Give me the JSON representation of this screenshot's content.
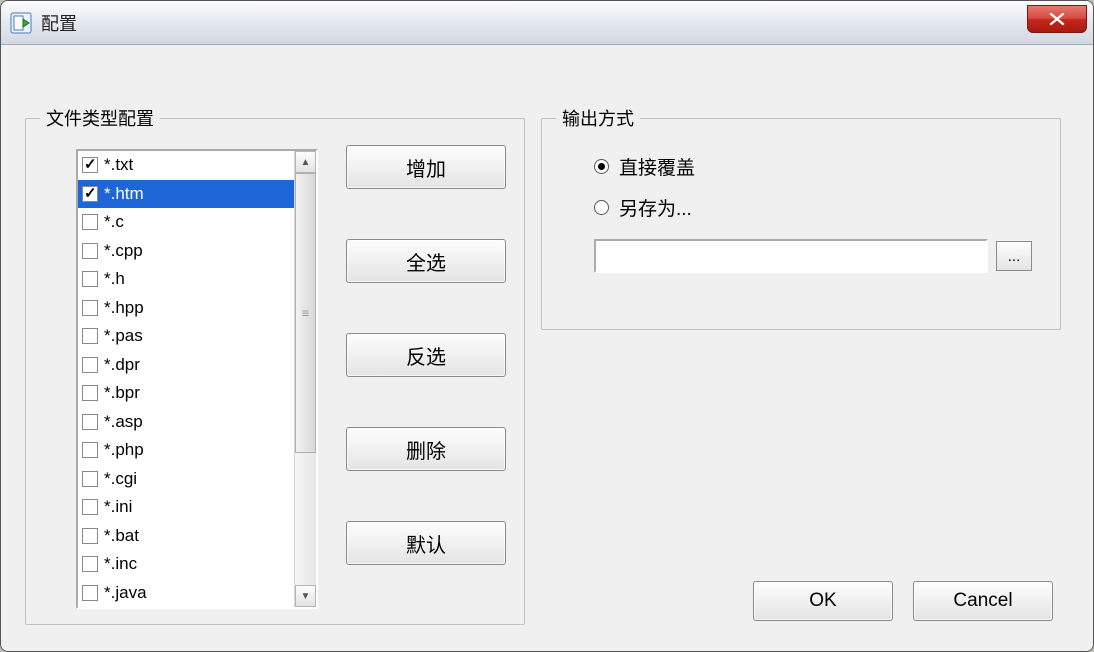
{
  "window": {
    "title": "配置"
  },
  "filetype_group": {
    "legend": "文件类型配置",
    "items": [
      {
        "label": "*.txt",
        "checked": true,
        "selected": false
      },
      {
        "label": "*.htm",
        "checked": true,
        "selected": true
      },
      {
        "label": "*.c",
        "checked": false,
        "selected": false
      },
      {
        "label": "*.cpp",
        "checked": false,
        "selected": false
      },
      {
        "label": "*.h",
        "checked": false,
        "selected": false
      },
      {
        "label": "*.hpp",
        "checked": false,
        "selected": false
      },
      {
        "label": "*.pas",
        "checked": false,
        "selected": false
      },
      {
        "label": "*.dpr",
        "checked": false,
        "selected": false
      },
      {
        "label": "*.bpr",
        "checked": false,
        "selected": false
      },
      {
        "label": "*.asp",
        "checked": false,
        "selected": false
      },
      {
        "label": "*.php",
        "checked": false,
        "selected": false
      },
      {
        "label": "*.cgi",
        "checked": false,
        "selected": false
      },
      {
        "label": "*.ini",
        "checked": false,
        "selected": false
      },
      {
        "label": "*.bat",
        "checked": false,
        "selected": false
      },
      {
        "label": "*.inc",
        "checked": false,
        "selected": false
      },
      {
        "label": "*.java",
        "checked": false,
        "selected": false
      }
    ],
    "buttons": {
      "add": "增加",
      "select_all": "全选",
      "invert": "反选",
      "delete": "删除",
      "default": "默认"
    }
  },
  "output_group": {
    "legend": "输出方式",
    "overwrite_label": "直接覆盖",
    "saveas_label": "另存为...",
    "selected": "overwrite",
    "path_value": "",
    "browse_label": "..."
  },
  "dialog_buttons": {
    "ok": "OK",
    "cancel": "Cancel"
  }
}
